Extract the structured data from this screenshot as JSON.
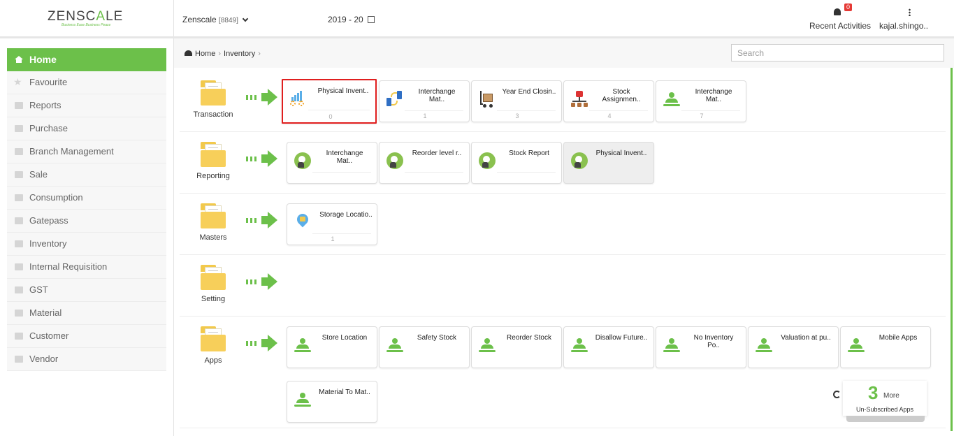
{
  "header": {
    "logo_left": "ZENSC",
    "logo_mid": "A",
    "logo_right": "LE",
    "tagline": "Business Ease Business Peace",
    "company_name": "Zenscale",
    "company_code": "[8849]",
    "fiscal_year": "2019 - 20",
    "notifications_count": "0",
    "recent_activities_label": "Recent Activities",
    "user_name": "kajal.shingo.."
  },
  "sidebar": {
    "items": [
      {
        "label": "Home"
      },
      {
        "label": "Favourite"
      },
      {
        "label": "Reports"
      },
      {
        "label": "Purchase"
      },
      {
        "label": "Branch Management"
      },
      {
        "label": "Sale"
      },
      {
        "label": "Consumption"
      },
      {
        "label": "Gatepass"
      },
      {
        "label": "Inventory"
      },
      {
        "label": "Internal Requisition"
      },
      {
        "label": "GST"
      },
      {
        "label": "Material"
      },
      {
        "label": "Customer"
      },
      {
        "label": "Vendor"
      }
    ]
  },
  "breadcrumb": {
    "home": "Home",
    "current": "Inventory"
  },
  "search": {
    "placeholder": "Search"
  },
  "sections": {
    "transaction": {
      "label": "Transaction",
      "cards": [
        {
          "title": "Physical Invent..",
          "count": "0"
        },
        {
          "title": "Interchange\nMat..",
          "count": "1"
        },
        {
          "title": "Year End Closin..",
          "count": "3"
        },
        {
          "title": "Stock\nAssignmen..",
          "count": "4"
        },
        {
          "title": "Interchange\nMat..",
          "count": "7"
        }
      ]
    },
    "reporting": {
      "label": "Reporting",
      "cards": [
        {
          "title": "Interchange\nMat.."
        },
        {
          "title": "Reorder level r.."
        },
        {
          "title": "Stock Report"
        },
        {
          "title": "Physical Invent.."
        }
      ]
    },
    "masters": {
      "label": "Masters",
      "cards": [
        {
          "title": "Storage Locatio..",
          "count": "1"
        }
      ]
    },
    "setting": {
      "label": "Setting"
    },
    "apps": {
      "label": "Apps",
      "cards": [
        {
          "title": "Store Location"
        },
        {
          "title": "Safety Stock"
        },
        {
          "title": "Reorder Stock"
        },
        {
          "title": "Disallow Future.."
        },
        {
          "title": "No Inventory\nPo.."
        },
        {
          "title": "Valuation at pu.."
        },
        {
          "title": "Mobile Apps"
        },
        {
          "title": "Material To Mat.."
        }
      ]
    }
  },
  "more_apps": {
    "count": "3",
    "word": "More",
    "subtitle": "Un-Subscribed Apps"
  },
  "colors": {
    "accent": "#6cc04a",
    "selection": "#e01f1f",
    "folder": "#f7cf5a"
  }
}
